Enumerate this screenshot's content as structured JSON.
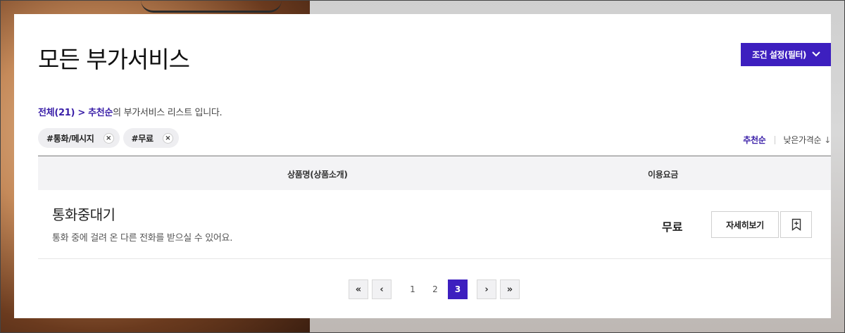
{
  "header": {
    "title": "모든 부가서비스",
    "filter_button_label": "조건 설정(필터)"
  },
  "summary": {
    "total": "전체(21)",
    "separator": " > ",
    "sort_name": "추천순",
    "suffix": "의 부가서비스 리스트 입니다."
  },
  "tags": [
    {
      "label": "#통화/메시지",
      "remove_icon": "×"
    },
    {
      "label": "#무료",
      "remove_icon": "×"
    }
  ],
  "sort": {
    "active": "추천순",
    "other": "낮은가격순",
    "other_arrow": "↓"
  },
  "table": {
    "columns": [
      "상품명(상품소개)",
      "이용요금"
    ],
    "rows": [
      {
        "name": "통화중대기",
        "description": "통화 중에 걸려 온 다른 전화를 받으실 수 있어요.",
        "fee": "무료",
        "detail_label": "자세히보기"
      }
    ]
  },
  "pagination": {
    "first": "«",
    "prev": "‹",
    "pages": [
      "1",
      "2",
      "3"
    ],
    "current": "3",
    "next": "›",
    "last": "»"
  },
  "colors": {
    "accent": "#3d1fbf",
    "accent_text": "#3a1fa8"
  }
}
